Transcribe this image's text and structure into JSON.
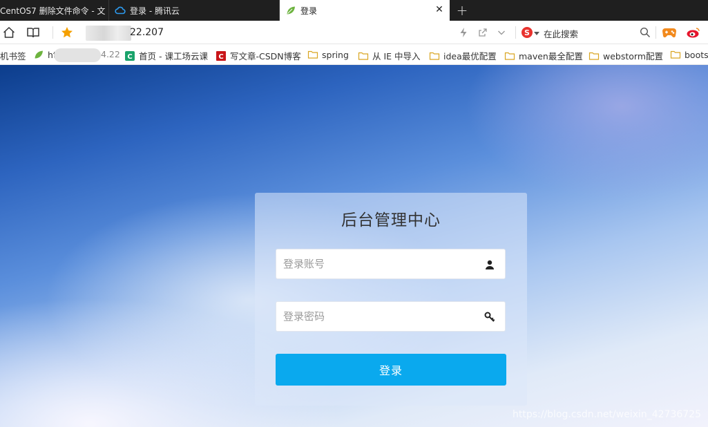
{
  "tabs": [
    {
      "title": "CentOS7 删除文件命令 - 文"
    },
    {
      "title": "登录 - 腾讯云"
    },
    {
      "title": "登录",
      "active": true
    }
  ],
  "address_bar": {
    "url_visible": "22.207",
    "search_engine_label": "在此搜索"
  },
  "bookmarks": [
    {
      "label": "机书签",
      "icon": "none"
    },
    {
      "label": "ht",
      "icon": "leaf-icon"
    },
    {
      "label": "4.22",
      "icon": "none"
    },
    {
      "label": "首页 - 课工场云课",
      "icon": "kgc-icon"
    },
    {
      "label": "写文章-CSDN博客",
      "icon": "csdn-icon"
    },
    {
      "label": "spring",
      "icon": "folder-icon"
    },
    {
      "label": "从 IE 中导入",
      "icon": "folder-icon"
    },
    {
      "label": "idea最优配置",
      "icon": "folder-icon"
    },
    {
      "label": "maven最全配置",
      "icon": "folder-icon"
    },
    {
      "label": "webstorm配置",
      "icon": "folder-icon"
    },
    {
      "label": "boots",
      "icon": "folder-icon"
    }
  ],
  "login": {
    "title": "后台管理中心",
    "username_placeholder": "登录账号",
    "password_placeholder": "登录密码",
    "submit_label": "登录"
  },
  "watermark": "https://blog.csdn.net/weixin_42736725",
  "colors": {
    "button": "#0aa9ee",
    "tabbar": "#1f1f1f",
    "star": "#f5a000",
    "csdn_red": "#c9161a",
    "kgc_green": "#1aa36b"
  }
}
